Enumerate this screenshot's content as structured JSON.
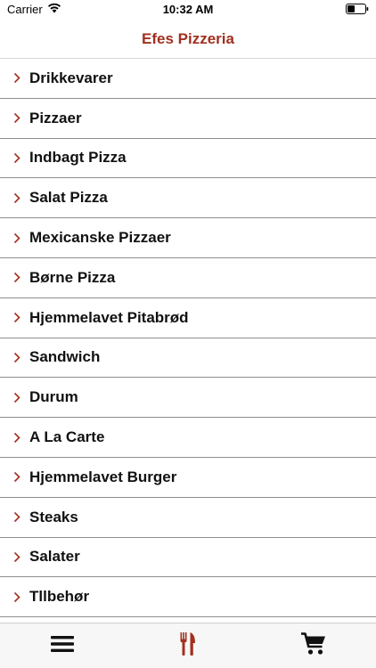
{
  "status_bar": {
    "carrier": "Carrier",
    "time": "10:32 AM",
    "wifi_icon": "wifi-icon",
    "battery_icon": "battery-icon"
  },
  "nav": {
    "title": "Efes Pizzeria"
  },
  "menu": {
    "items": [
      {
        "label": "Drikkevarer"
      },
      {
        "label": "Pizzaer"
      },
      {
        "label": "Indbagt Pizza"
      },
      {
        "label": "Salat Pizza"
      },
      {
        "label": "Mexicanske Pizzaer"
      },
      {
        "label": "Børne Pizza"
      },
      {
        "label": "Hjemmelavet Pitabrød"
      },
      {
        "label": "Sandwich"
      },
      {
        "label": "Durum"
      },
      {
        "label": "A La Carte"
      },
      {
        "label": "Hjemmelavet Burger"
      },
      {
        "label": "Steaks"
      },
      {
        "label": "Salater"
      },
      {
        "label": "Tllbehør"
      }
    ]
  },
  "tab_bar": {
    "tabs": [
      {
        "icon": "hamburger-menu-icon"
      },
      {
        "icon": "fork-knife-icon",
        "selected": true
      },
      {
        "icon": "shopping-cart-icon"
      }
    ]
  },
  "colors": {
    "accent": "#a1301f",
    "text": "#111111",
    "divider": "#8e8e8e",
    "tab_bar_bg": "#f7f7f7"
  }
}
